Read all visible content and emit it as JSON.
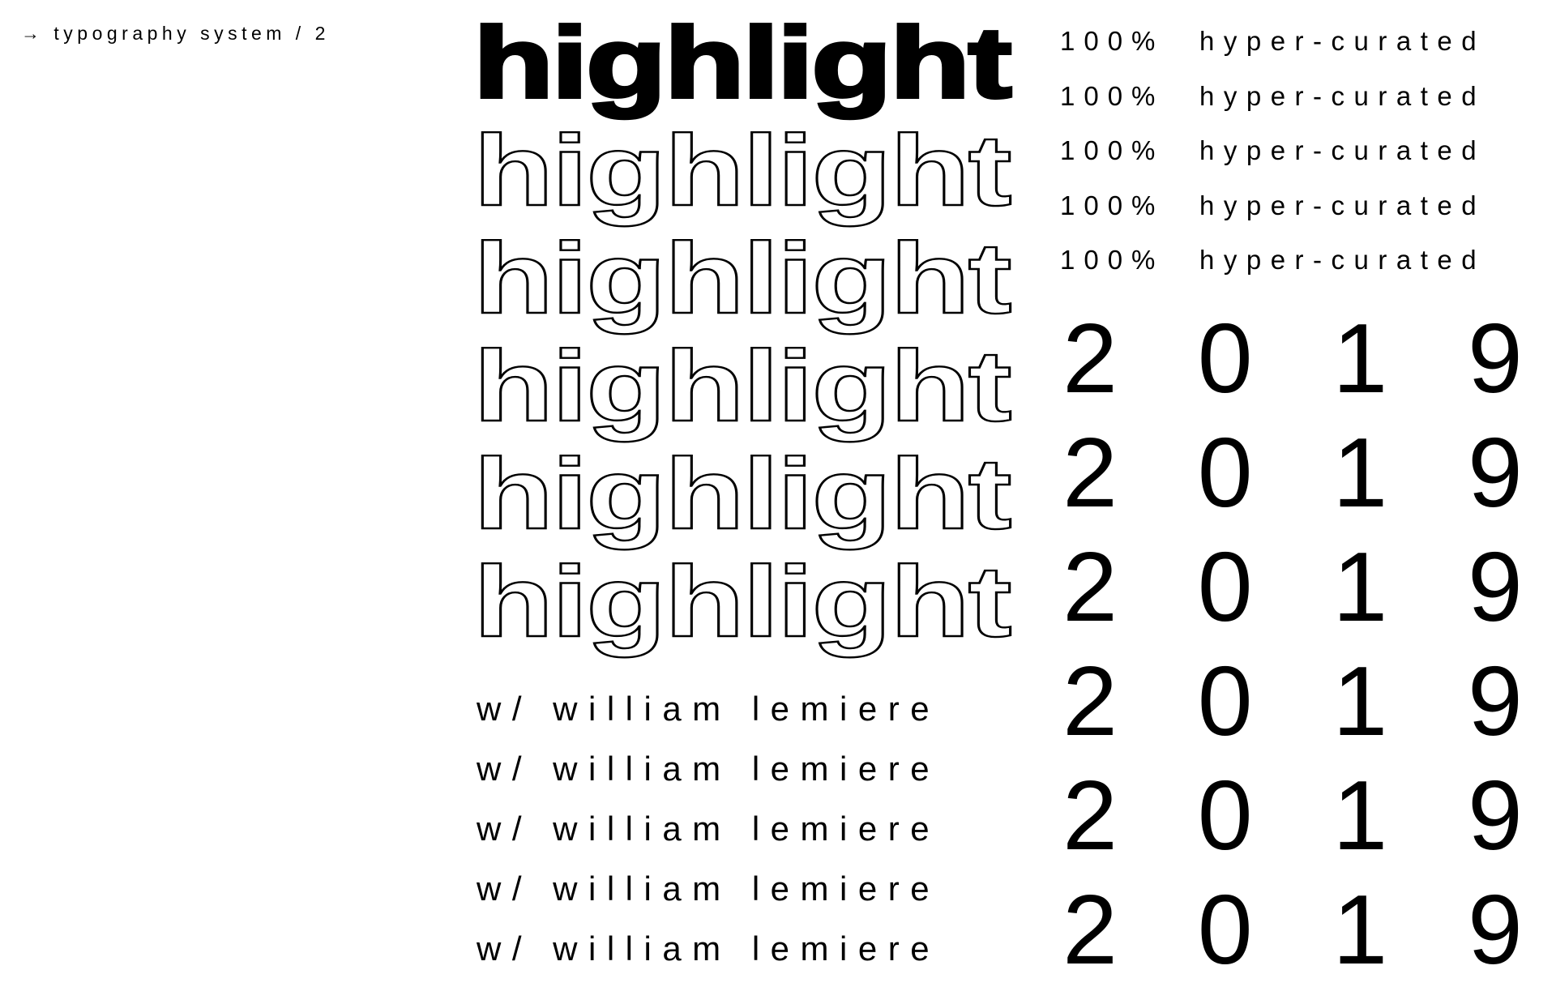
{
  "caption": "→ typography system / 2",
  "highlight": {
    "word": "highlight",
    "rows": [
      {
        "style": "solid"
      },
      {
        "style": "outline"
      },
      {
        "style": "outline"
      },
      {
        "style": "outline"
      },
      {
        "style": "outline"
      },
      {
        "style": "outline"
      }
    ]
  },
  "credit": {
    "text": "w/  william  lemiere",
    "repeat": 5
  },
  "tagline": {
    "percent": "100%",
    "word": "hyper-curated",
    "repeat": 5
  },
  "year": {
    "digits": [
      "2",
      "0",
      "1",
      "9"
    ],
    "repeat": 6
  },
  "colors": {
    "ink": "#000000",
    "background": "#ffffff"
  }
}
